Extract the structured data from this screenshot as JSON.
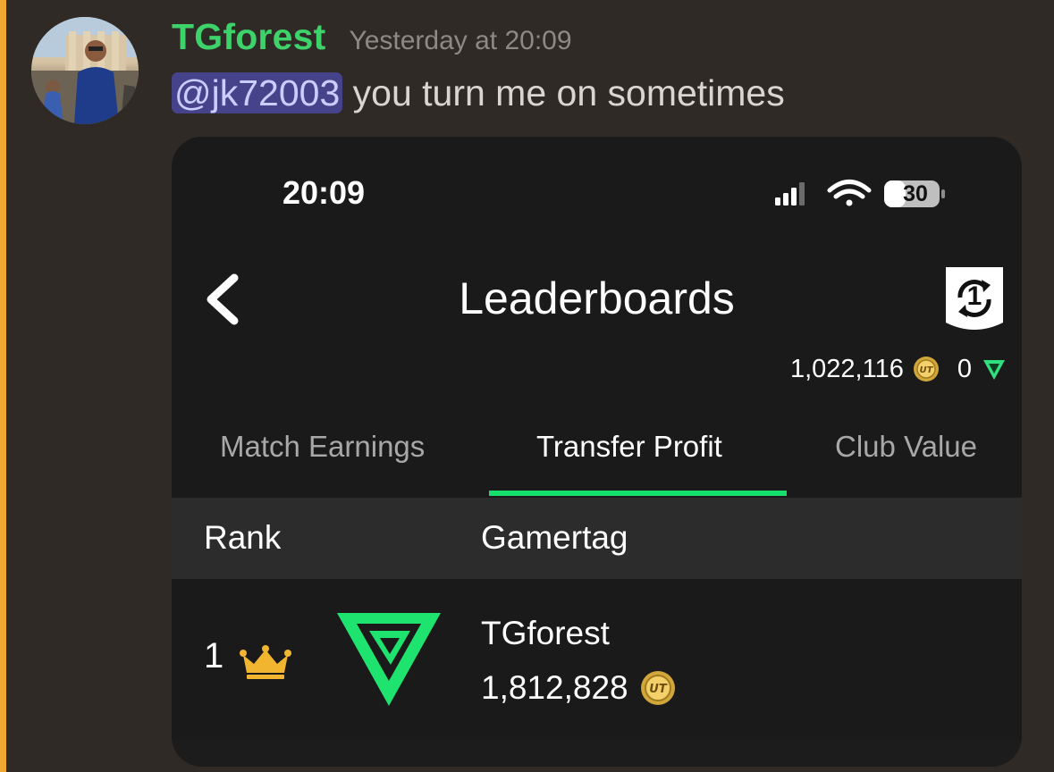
{
  "message": {
    "author": "TGforest",
    "timestamp": "Yesterday at 20:09",
    "mention": "@jk72003",
    "text": " you turn me on sometimes"
  },
  "screenshot": {
    "status_bar": {
      "time": "20:09",
      "battery": "30"
    },
    "screen_title": "Leaderboards",
    "sync_badge": "1",
    "currency": {
      "coins": "1,022,116",
      "points": "0"
    },
    "tabs": [
      {
        "label": "Match Earnings",
        "active": false
      },
      {
        "label": "Transfer Profit",
        "active": true
      },
      {
        "label": "Club Value",
        "active": false
      }
    ],
    "table": {
      "headers": {
        "rank": "Rank",
        "gamertag": "Gamertag"
      },
      "rows": [
        {
          "rank": "1",
          "gamertag": "TGforest",
          "value": "1,812,828"
        }
      ]
    }
  },
  "icons": {
    "coin_text": "UT"
  },
  "colors": {
    "author": "#3dd26a",
    "mention_bg": "#47438a",
    "accent_green": "#18de6e",
    "highlight_bar": "#f0a731",
    "crown": "#f2b530"
  }
}
